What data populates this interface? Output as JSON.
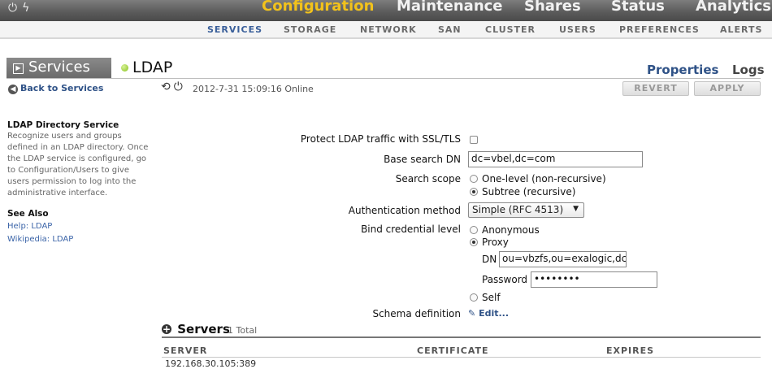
{
  "topnav": {
    "tabs": [
      "Configuration",
      "Maintenance",
      "Shares",
      "Status",
      "Analytics"
    ],
    "active": "Configuration"
  },
  "subnav": {
    "items": [
      "SERVICES",
      "STORAGE",
      "NETWORK",
      "SAN",
      "CLUSTER",
      "USERS",
      "PREFERENCES",
      "ALERTS"
    ],
    "active": "SERVICES"
  },
  "header": {
    "section": "Services",
    "service": "LDAP",
    "status_color": "#86c21a",
    "tabs": [
      "Properties",
      "Logs"
    ],
    "active_tab": "Properties"
  },
  "back_link": "Back to Services",
  "status_line": "2012-7-31 15:09:16 Online",
  "buttons": {
    "revert": "REVERT",
    "apply": "APPLY"
  },
  "sidebar": {
    "title": "LDAP Directory Service",
    "description": "Recognize users and groups defined in an LDAP directory. Once the LDAP service is configured, go to Configuration/Users to give users permission to log into the administrative interface.",
    "see_also_title": "See Also",
    "links": [
      "Help: LDAP",
      "Wikipedia: LDAP"
    ]
  },
  "form": {
    "protect_label": "Protect LDAP traffic with SSL/TLS",
    "protect_checked": false,
    "base_dn_label": "Base search DN",
    "base_dn_value": "dc=vbel,dc=com",
    "scope_label": "Search scope",
    "scope_options": [
      "One-level (non-recursive)",
      "Subtree (recursive)"
    ],
    "scope_selected": "Subtree (recursive)",
    "auth_label": "Authentication method",
    "auth_value": "Simple (RFC 4513)",
    "bind_label": "Bind credential level",
    "bind_options": [
      "Anonymous",
      "Proxy",
      "Self"
    ],
    "bind_selected": "Proxy",
    "dn_label": "DN",
    "dn_value": "ou=vbzfs,ou=exalogic,dc=",
    "password_label": "Password",
    "password_value": "••••••••",
    "schema_label": "Schema definition",
    "schema_edit": "Edit..."
  },
  "servers": {
    "title": "Servers",
    "count": "1 Total",
    "columns": [
      "SERVER",
      "CERTIFICATE",
      "EXPIRES"
    ],
    "rows": [
      {
        "server": "192.168.30.105:389"
      }
    ]
  }
}
